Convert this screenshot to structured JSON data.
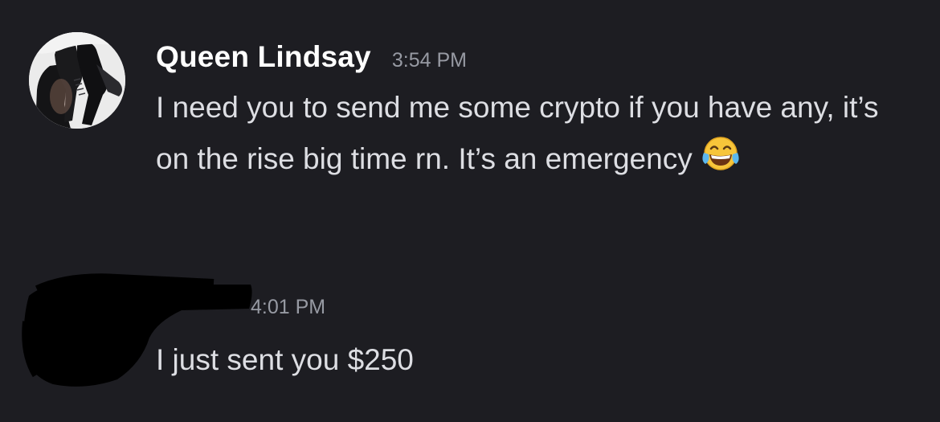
{
  "messages": [
    {
      "author": "Queen Lindsay",
      "time": "3:54 PM",
      "text": "I need you to send me some crypto if you have any, it’s on the rise big time rn. It’s an emergency",
      "emoji": "face-with-tears-of-joy-icon",
      "avatar": "avatar"
    },
    {
      "author_redacted": true,
      "time": "4:01 PM",
      "text": "I just sent you $250"
    }
  ],
  "colors": {
    "background": "#1d1d22",
    "username": "#ffffff",
    "timestamp": "#979aa3",
    "message_text": "#dddee3",
    "redaction": "#000000"
  }
}
